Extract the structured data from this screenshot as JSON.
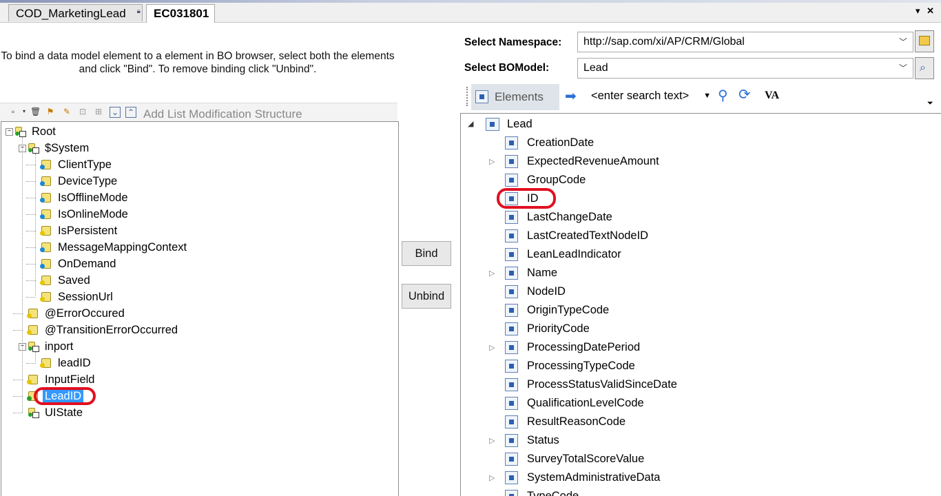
{
  "tabs": [
    {
      "label": "COD_MarketingLead",
      "active": false
    },
    {
      "label": "EC031801",
      "active": true
    }
  ],
  "instructions": "To bind a data model element to a element in BO browser, select both the elements and click \"Bind\". To remove binding click \"Unbind\".",
  "left_toolbar": {
    "add_list_label": "Add List Modification Structure"
  },
  "data_model_tree": [
    {
      "label": "Root",
      "level": 0,
      "expanded": true,
      "icon": "structure-icon"
    },
    {
      "label": "$System",
      "level": 1,
      "expanded": true,
      "icon": "structure-icon"
    },
    {
      "label": "ClientType",
      "level": 2,
      "icon": "element-blue-icon"
    },
    {
      "label": "DeviceType",
      "level": 2,
      "icon": "element-blue-icon"
    },
    {
      "label": "IsOfflineMode",
      "level": 2,
      "icon": "element-blue-icon"
    },
    {
      "label": "IsOnlineMode",
      "level": 2,
      "icon": "element-blue-icon"
    },
    {
      "label": "IsPersistent",
      "level": 2,
      "icon": "element-yellow-icon"
    },
    {
      "label": "MessageMappingContext",
      "level": 2,
      "icon": "element-blue-icon"
    },
    {
      "label": "OnDemand",
      "level": 2,
      "icon": "element-blue-icon"
    },
    {
      "label": "Saved",
      "level": 2,
      "icon": "element-yellow-icon"
    },
    {
      "label": "SessionUrl",
      "level": 2,
      "icon": "element-yellow-icon"
    },
    {
      "label": "@ErrorOccured",
      "level": 1,
      "icon": "element-yellow-icon"
    },
    {
      "label": "@TransitionErrorOccurred",
      "level": 1,
      "icon": "element-yellow-icon"
    },
    {
      "label": "inport",
      "level": 1,
      "expanded": true,
      "icon": "structure-icon"
    },
    {
      "label": "leadID",
      "level": 2,
      "icon": "element-yellow-icon"
    },
    {
      "label": "InputField",
      "level": 1,
      "icon": "element-yellow-icon"
    },
    {
      "label": "LeadID",
      "level": 1,
      "icon": "element-green-icon",
      "selected": true,
      "highlighted": true
    },
    {
      "label": "UIState",
      "level": 1,
      "icon": "structure-icon"
    }
  ],
  "buttons": {
    "bind": "Bind",
    "unbind": "Unbind"
  },
  "namespace": {
    "label": "Select Namespace:",
    "value": "http://sap.com/xi/AP/CRM/Global"
  },
  "bo_model": {
    "label": "Select BOModel:",
    "value": "Lead"
  },
  "right_toolbar": {
    "elements_label": "Elements",
    "search_placeholder": "<enter search text>",
    "va_label": "VA"
  },
  "bo_tree": {
    "root": "Lead",
    "items": [
      {
        "label": "CreationDate",
        "expandable": false
      },
      {
        "label": "ExpectedRevenueAmount",
        "expandable": true
      },
      {
        "label": "GroupCode",
        "expandable": false
      },
      {
        "label": "ID",
        "expandable": false,
        "highlighted": true
      },
      {
        "label": "LastChangeDate",
        "expandable": false
      },
      {
        "label": "LastCreatedTextNodeID",
        "expandable": false
      },
      {
        "label": "LeanLeadIndicator",
        "expandable": false
      },
      {
        "label": "Name",
        "expandable": true
      },
      {
        "label": "NodeID",
        "expandable": false
      },
      {
        "label": "OriginTypeCode",
        "expandable": false
      },
      {
        "label": "PriorityCode",
        "expandable": false
      },
      {
        "label": "ProcessingDatePeriod",
        "expandable": true
      },
      {
        "label": "ProcessingTypeCode",
        "expandable": false
      },
      {
        "label": "ProcessStatusValidSinceDate",
        "expandable": false
      },
      {
        "label": "QualificationLevelCode",
        "expandable": false
      },
      {
        "label": "ResultReasonCode",
        "expandable": false
      },
      {
        "label": "Status",
        "expandable": true
      },
      {
        "label": "SurveyTotalScoreValue",
        "expandable": false
      },
      {
        "label": "SystemAdministrativeData",
        "expandable": true
      },
      {
        "label": "TypeCode",
        "expandable": false
      }
    ]
  },
  "colors": {
    "highlight": "#e01020",
    "selection": "#3399ff",
    "element_icon": "#2b5fb0"
  }
}
